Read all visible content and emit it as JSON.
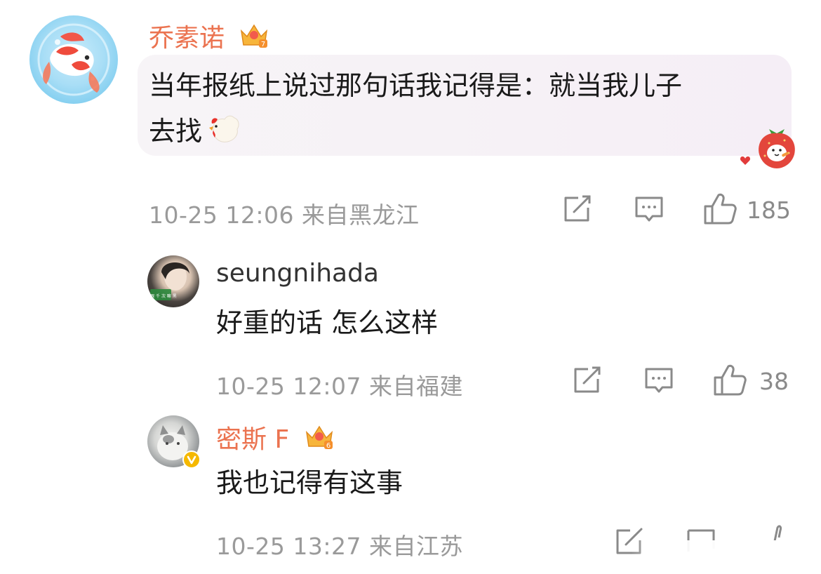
{
  "comments": [
    {
      "username": "乔素诺",
      "text_line1": "当年报纸上说过那句话我记得是：就当我儿子",
      "text_line2": "去找",
      "emoji": "chicken-emoji",
      "meta": "10-25 12:06 来自黑龙江",
      "likes": "185"
    },
    {
      "username": "seungnihada",
      "text": "好重的话 怎么这样",
      "meta": "10-25 12:07 来自福建",
      "likes": "38"
    },
    {
      "username": "密斯 F",
      "text": "我也记得有这事",
      "meta": "10-25 13:27 来自江苏"
    }
  ],
  "avatar_r1_badge_text": "开 眼 千 次 嘛 黑",
  "colors": {
    "username_orange": "#eb7350",
    "meta_gray": "#9a9a9a",
    "icon_gray": "#8a8a8a",
    "verified_yellow": "#f5b800"
  }
}
